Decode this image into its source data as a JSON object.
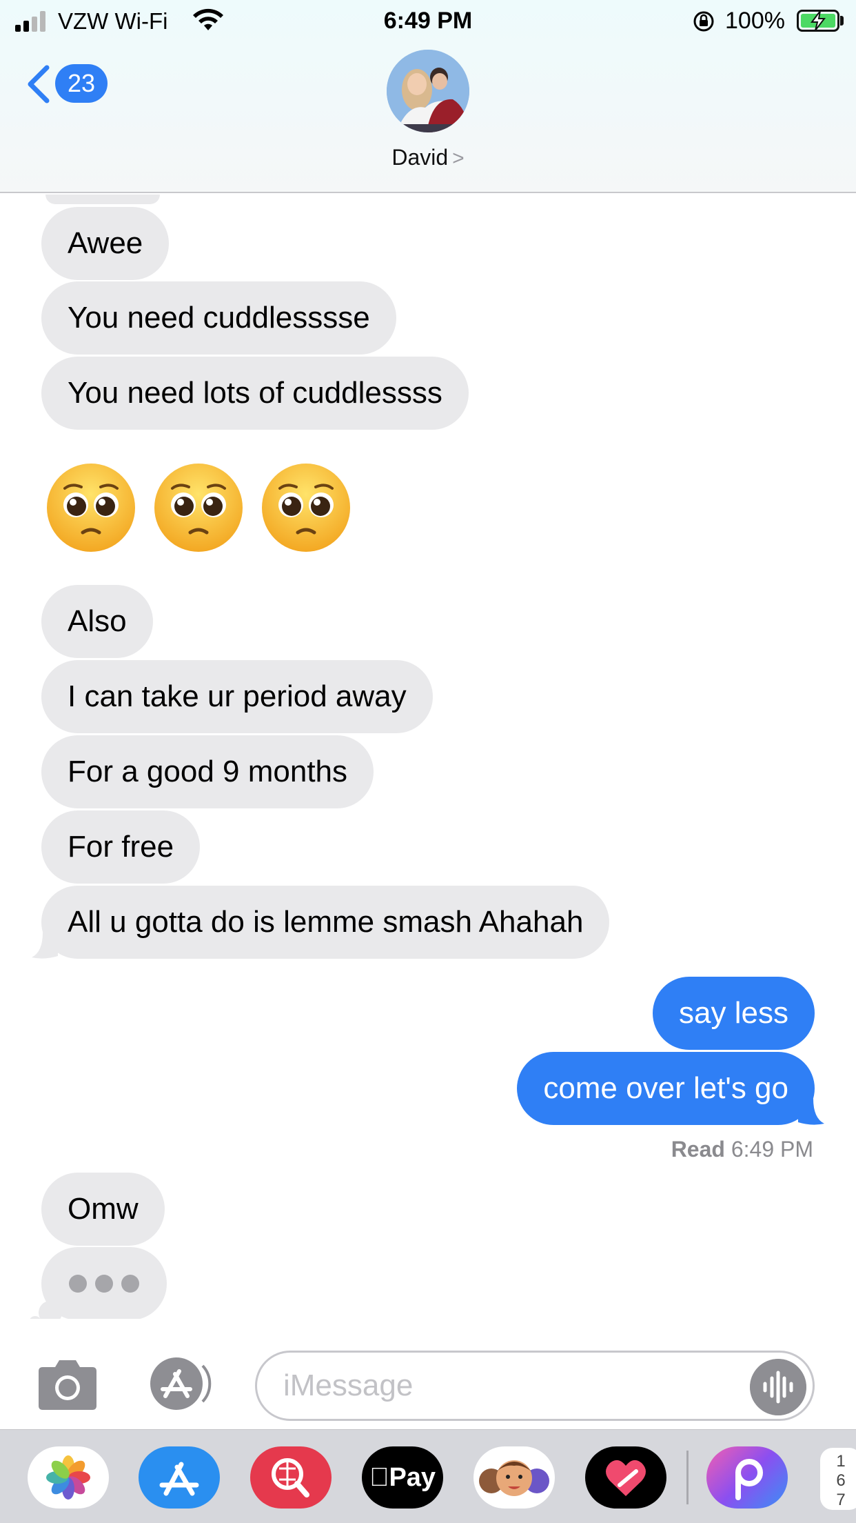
{
  "status_bar": {
    "carrier": "VZW Wi-Fi",
    "time": "6:49 PM",
    "battery_percent": "100%",
    "battery_level": 1.0,
    "signal_bars": 2
  },
  "header": {
    "back_badge": "23",
    "contact_name": "David",
    "chevron": ">"
  },
  "messages": [
    {
      "direction": "incoming",
      "text": "Awee"
    },
    {
      "direction": "incoming",
      "text": "You need cuddlesssse"
    },
    {
      "direction": "incoming",
      "text": "You need lots of cuddlessss"
    },
    {
      "direction": "incoming",
      "type": "emoji",
      "text": "🥺🥺🥺"
    },
    {
      "direction": "incoming",
      "text": "Also"
    },
    {
      "direction": "incoming",
      "text": "I can take ur period away"
    },
    {
      "direction": "incoming",
      "text": "For a good 9 months"
    },
    {
      "direction": "incoming",
      "text": "For free"
    },
    {
      "direction": "incoming",
      "text": "All u gotta do is lemme smash Ahahah"
    },
    {
      "direction": "outgoing",
      "text": "say less"
    },
    {
      "direction": "outgoing",
      "text": "come over let's go"
    },
    {
      "direction": "incoming",
      "text": "Omw"
    }
  ],
  "read_receipt": {
    "label": "Read",
    "time": "6:49 PM"
  },
  "typing_indicator": true,
  "input": {
    "placeholder": "iMessage"
  },
  "app_drawer": {
    "apps": [
      "photos-app",
      "app-store",
      "web-images",
      "apple-pay",
      "memoji",
      "digital-touch",
      "picsart"
    ],
    "apple_pay_label": "Pay",
    "counter_digits": [
      "1",
      "6",
      "7"
    ]
  },
  "colors": {
    "outgoing_bubble": "#2f7ff5",
    "incoming_bubble": "#e9e9eb",
    "badge": "#2f7ff5"
  }
}
